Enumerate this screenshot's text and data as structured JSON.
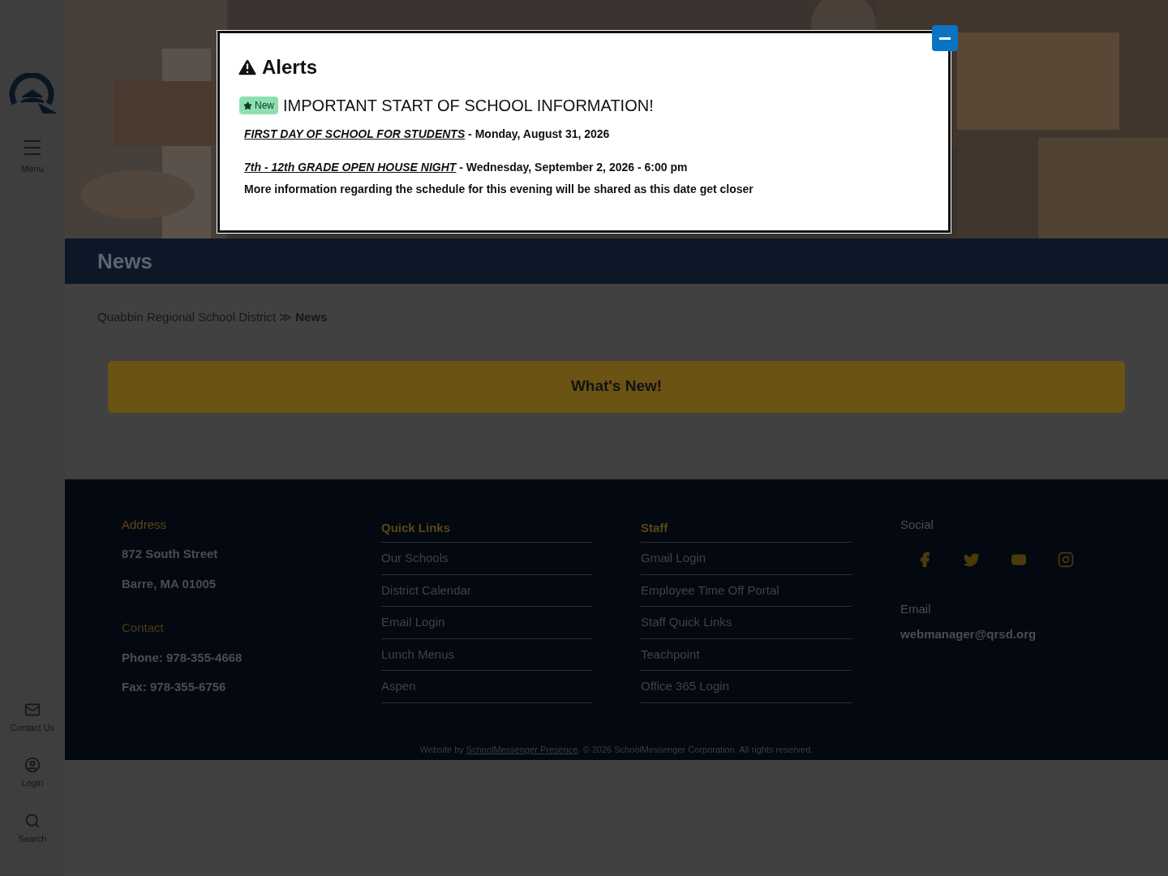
{
  "sidebar": {
    "items": [
      {
        "kind": "menu",
        "label": "Menu"
      },
      {
        "kind": "contact",
        "label": "Contact Us"
      },
      {
        "kind": "login",
        "label": "Login"
      },
      {
        "kind": "search",
        "label": "Search"
      }
    ]
  },
  "page_title": "News",
  "breadcrumb": {
    "items": [
      "Quabbin Regional School District"
    ],
    "separator": "≫",
    "current": "News"
  },
  "whats_new": "What's New!",
  "alert": {
    "title": "Alerts",
    "badge": "New",
    "heading": "IMPORTANT START OF SCHOOL INFORMATION!",
    "lines": [
      {
        "link": "FIRST DAY OF SCHOOL FOR STUDENTS",
        "text": " - Monday, August 31, 2026"
      },
      {
        "link": "7th - 12th GRADE OPEN HOUSE NIGHT",
        "text": " - Wednesday, September 2, 2026 - 6:00 pm"
      }
    ],
    "note": "More information regarding the schedule for this evening will be shared as this date get closer"
  },
  "footer": {
    "address": {
      "heading": "Address",
      "lines": [
        "872 South Street",
        "Barre, MA 01005"
      ]
    },
    "contact": {
      "heading": "Contact",
      "lines": [
        "Phone: 978-355-4668",
        "Fax: 978-355-6756"
      ]
    },
    "quick_links": {
      "heading": "Quick Links",
      "items": [
        "Our Schools",
        "District Calendar",
        "Email Login",
        "Lunch Menus",
        "Aspen"
      ]
    },
    "staff": {
      "heading": "Staff",
      "items": [
        "Gmail Login",
        "Employee Time Off Portal",
        "Staff Quick Links",
        "Teachpoint",
        "Office 365 Login"
      ]
    },
    "social": {
      "heading": "Social",
      "items": [
        {
          "kind": "facebook"
        },
        {
          "kind": "twitter"
        },
        {
          "kind": "youtube"
        },
        {
          "kind": "instagram"
        }
      ]
    },
    "email": {
      "heading": "Email",
      "value": "webmanager@qrsd.org"
    },
    "credit": {
      "prefix": "Website by ",
      "link": "SchoolMessenger Presence",
      "suffix": ". © 2026 SchoolMessenger Corporation. All rights reserved."
    }
  }
}
